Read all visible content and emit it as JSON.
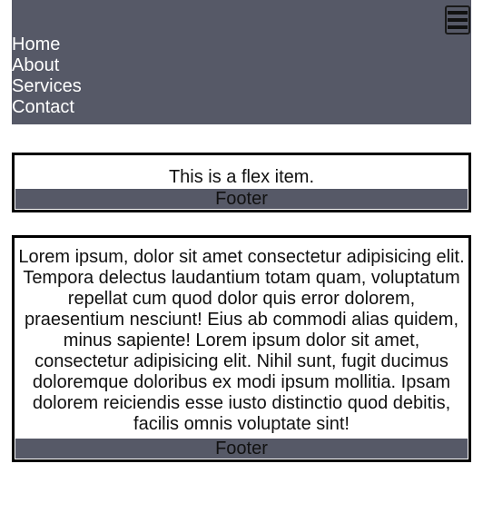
{
  "nav": {
    "links": [
      "Home",
      "About",
      "Services",
      "Contact"
    ],
    "menu_icon": "hamburger-menu-icon",
    "background": "#565967",
    "link_color": "#ffffff"
  },
  "cards": [
    {
      "text": "This is a flex item.",
      "footer": "Footer"
    },
    {
      "text": "Lorem ipsum, dolor sit amet consectetur adipisicing elit. Tempora delectus laudantium totam quam, voluptatum repellat cum quod dolor quis error dolorem, praesentium nesciunt! Eius ab commodi alias quidem, minus sapiente! Lorem ipsum dolor sit amet, consectetur adipisicing elit. Nihil sunt, fugit ducimus doloremque doloribus ex modi ipsum mollitia. Ipsam dolorem reiciendis esse iusto distinctio quod debitis, facilis omnis voluptate sint!",
      "footer": "Footer"
    }
  ],
  "colors": {
    "footer_bg": "#565967",
    "card_border": "#000000"
  }
}
